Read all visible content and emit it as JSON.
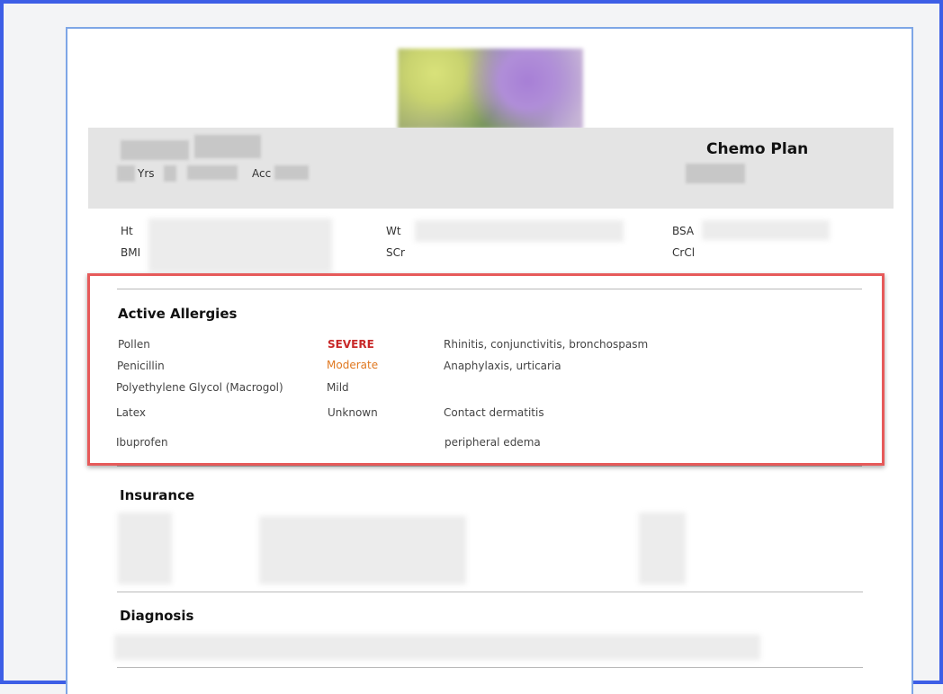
{
  "header": {
    "age_unit": "Yrs",
    "acc_label": "Acc",
    "plan_title": "Chemo Plan"
  },
  "vitals": {
    "ht_label": "Ht",
    "bmi_label": "BMI",
    "wt_label": "Wt",
    "scr_label": "SCr",
    "bsa_label": "BSA",
    "crcl_label": "CrCl"
  },
  "allergies": {
    "title": "Active Allergies",
    "items": [
      {
        "name": "Pollen",
        "severity": "SEVERE",
        "reaction": "Rhinitis, conjunctivitis, bronchospasm"
      },
      {
        "name": "Penicillin",
        "severity": "Moderate",
        "reaction": "Anaphylaxis, urticaria"
      },
      {
        "name": "Polyethylene Glycol (Macrogol)",
        "severity": "Mild",
        "reaction": ""
      },
      {
        "name": "Latex",
        "severity": "Unknown",
        "reaction": "Contact dermatitis"
      },
      {
        "name": "Ibuprofen",
        "severity": "",
        "reaction": "peripheral edema"
      }
    ]
  },
  "insurance": {
    "title": "Insurance"
  },
  "diagnosis": {
    "title": "Diagnosis"
  },
  "colors": {
    "frame_border": "#3d5ee6",
    "highlight_border": "#e65a5a",
    "severe": "#c82828",
    "moderate": "#e07820"
  }
}
